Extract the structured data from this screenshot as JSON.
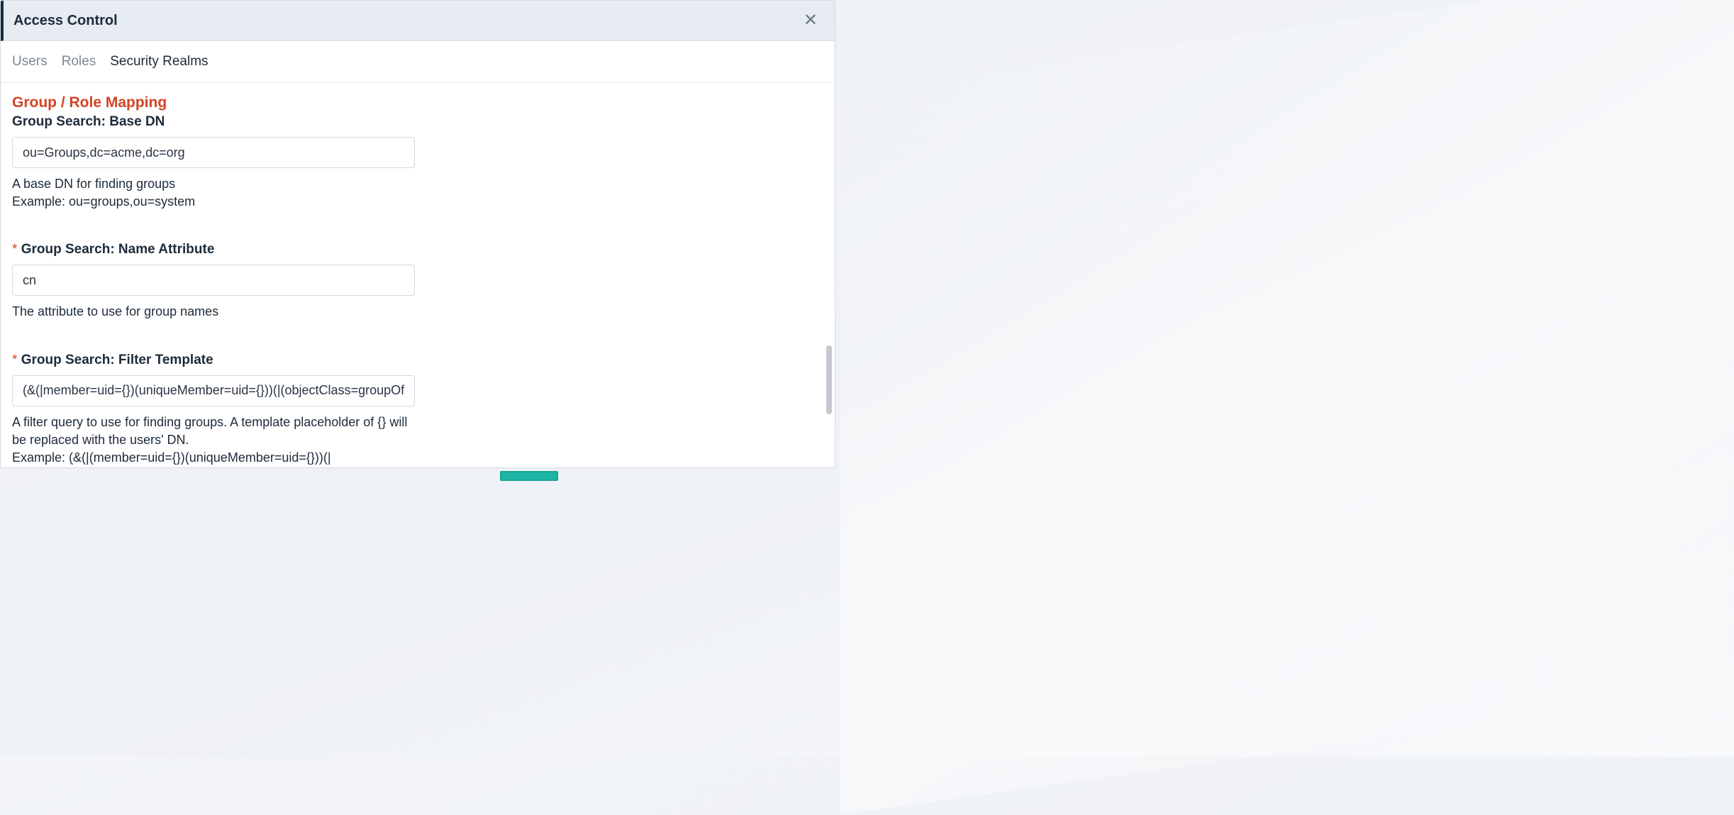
{
  "header": {
    "title": "Access Control"
  },
  "tabs": {
    "users": "Users",
    "roles": "Roles",
    "security_realms": "Security Realms"
  },
  "section": {
    "title": "Group / Role Mapping"
  },
  "fields": {
    "base_dn": {
      "label": "Group Search: Base DN",
      "value": "ou=Groups,dc=acme,dc=org",
      "help1": "A base DN for finding groups",
      "help2": "Example: ou=groups,ou=system"
    },
    "name_attr": {
      "label": "Group Search: Name Attribute",
      "value": "cn",
      "help": "The attribute to use for group names"
    },
    "filter": {
      "label": "Group Search: Filter Template",
      "value": "(&(|member=uid={})(uniqueMember=uid={}))(|(objectClass=groupOf",
      "help1": "A filter query to use for finding groups. A template placeholder of {} will be replaced with the users' DN.",
      "help2": "Example: (&(|(member=uid={})(uniqueMember=uid={}))(|(objectClass=groupOfNames)(objectClass=groupOfUniqueNames)))"
    }
  }
}
